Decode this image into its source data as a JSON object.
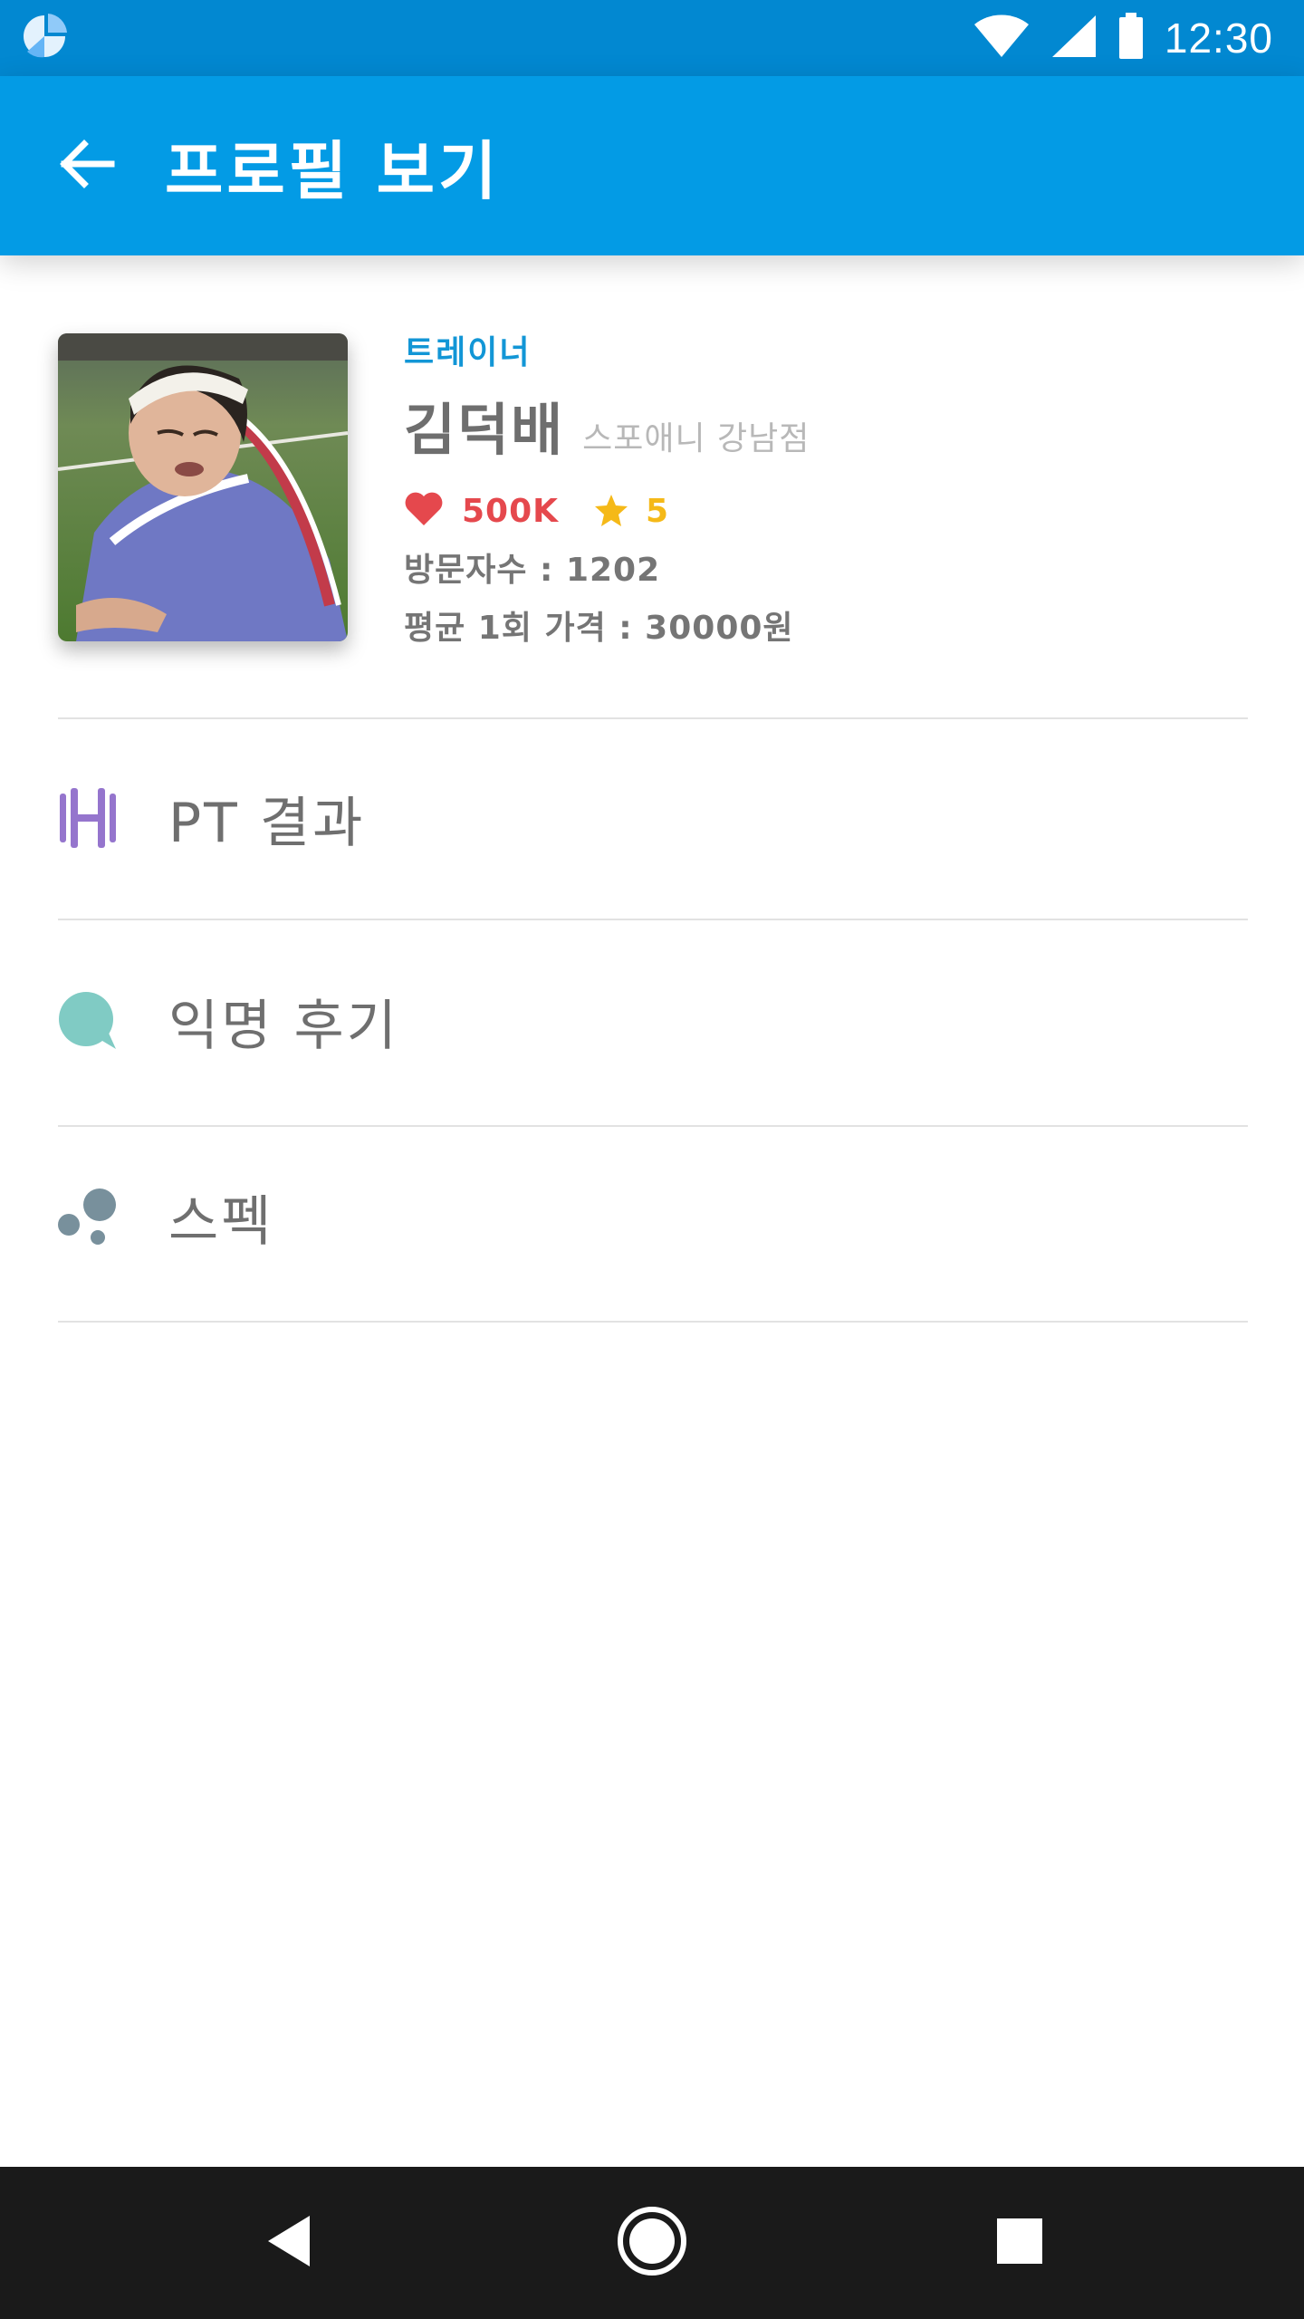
{
  "status_bar": {
    "time": "12:30",
    "icons": [
      "app-logo-icon",
      "wifi-icon",
      "signal-icon",
      "battery-icon"
    ]
  },
  "app_bar": {
    "title": "프로필 보기",
    "back_icon": "arrow-back-icon"
  },
  "profile": {
    "role": "트레이너",
    "name": "김덕배",
    "branch": "스포애니 강남점",
    "likes": "500K",
    "rating": "5",
    "visitors": "방문자수 : 1202",
    "avg_price": "평균 1회 가격 : 30000원"
  },
  "menu": {
    "items": [
      {
        "label": "PT 결과",
        "icon": "dumbbell-icon",
        "color": "#9575cd"
      },
      {
        "label": "익명 후기",
        "icon": "chat-bubble-icon",
        "color": "#80cbc4"
      },
      {
        "label": "스펙",
        "icon": "bubbles-icon",
        "color": "#78909c"
      }
    ]
  },
  "colors": {
    "status_bar": "#0288d1",
    "app_bar": "#039be5",
    "accent_blue": "#1296d6",
    "heart_red": "#e5484d",
    "star_yellow": "#f5b918",
    "nav_bar": "#1a1a1a"
  },
  "nav": {
    "icons": [
      "back-triangle-icon",
      "home-circle-icon",
      "recents-square-icon"
    ]
  }
}
